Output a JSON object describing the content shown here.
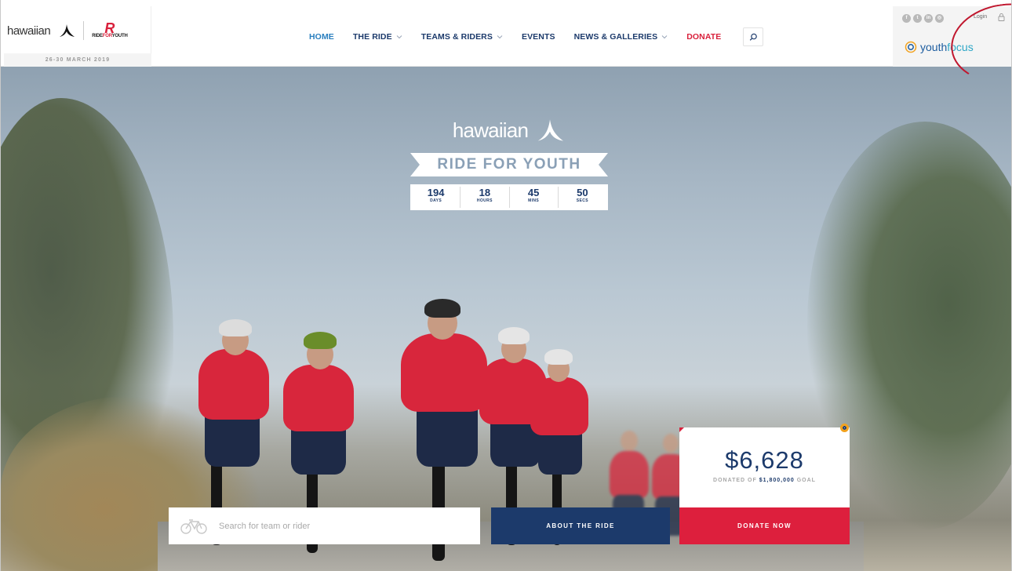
{
  "header": {
    "brand": {
      "hawaiian_word": "hawaiian",
      "rfy_text_black": "RIDE",
      "rfy_text_red": "FOR",
      "rfy_text_end": "YOUTH",
      "date": "26-30 MARCH 2019"
    },
    "nav": [
      {
        "label": "HOME",
        "active": true,
        "dropdown": false
      },
      {
        "label": "THE RIDE",
        "active": false,
        "dropdown": true
      },
      {
        "label": "TEAMS & RIDERS",
        "active": false,
        "dropdown": true
      },
      {
        "label": "EVENTS",
        "active": false,
        "dropdown": false
      },
      {
        "label": "NEWS & GALLERIES",
        "active": false,
        "dropdown": true
      },
      {
        "label": "DONATE",
        "active": false,
        "dropdown": false
      }
    ],
    "search_icon": "search-icon",
    "utility": {
      "socials": [
        "facebook-icon",
        "twitter-icon",
        "linkedin-icon",
        "instagram-icon"
      ],
      "login_label": "Login",
      "partner_word1": "youth",
      "partner_word2": "focus"
    }
  },
  "hero": {
    "hawaiian_word": "hawaiian",
    "ribbon": "RIDE FOR YOUTH",
    "countdown": [
      {
        "value": "194",
        "label": "DAYS"
      },
      {
        "value": "18",
        "label": "HOURS"
      },
      {
        "value": "45",
        "label": "MINS"
      },
      {
        "value": "50",
        "label": "SECS"
      }
    ],
    "donation": {
      "amount": "$6,628",
      "prefix": "DONATED OF",
      "goal": "$1,800,000",
      "suffix": "GOAL"
    },
    "search_placeholder": "Search for team or rider",
    "about_button": "ABOUT THE RIDE",
    "donate_button": "DONATE NOW"
  },
  "colors": {
    "navy": "#1c3a6b",
    "red": "#dd1f3d",
    "active_link": "#2a7fbf"
  }
}
